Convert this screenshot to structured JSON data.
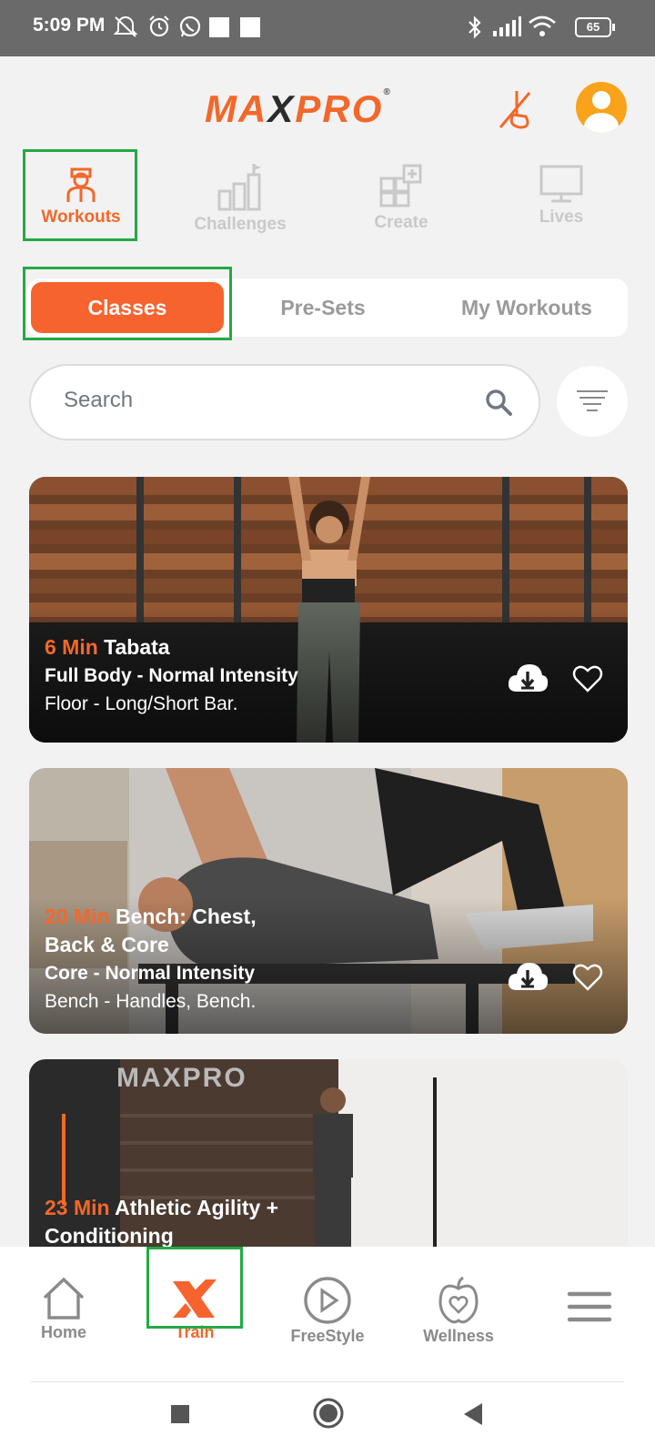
{
  "status_bar": {
    "time": "5:09 PM",
    "battery": "65",
    "icons": [
      "mute-icon",
      "alarm-icon",
      "whatsapp-icon",
      "bluetooth-icon",
      "signal-icon",
      "wifi-icon"
    ]
  },
  "header": {
    "logo_text_left": "MA",
    "logo_text_x": "X",
    "logo_text_right": "PRO",
    "logo_reg": "®"
  },
  "category_tabs": [
    {
      "label": "Workouts",
      "icon": "trainer-icon",
      "active": true
    },
    {
      "label": "Challenges",
      "icon": "podium-flag-icon",
      "active": false
    },
    {
      "label": "Create",
      "icon": "grid-plus-icon",
      "active": false
    },
    {
      "label": "Lives",
      "icon": "monitor-icon",
      "active": false
    }
  ],
  "segments": [
    {
      "label": "Classes",
      "active": true
    },
    {
      "label": "Pre-Sets",
      "active": false
    },
    {
      "label": "My Workouts",
      "active": false
    }
  ],
  "search": {
    "placeholder": "Search"
  },
  "cards": [
    {
      "duration": "6 Min",
      "title": "Tabata",
      "subtitle": "Full Body - Normal Intensity",
      "equipment": "Floor - Long/Short Bar."
    },
    {
      "duration": "20 Min",
      "title": "Bench: Chest,",
      "title_line2": "Back & Core",
      "subtitle": "Core - Normal Intensity",
      "equipment": "Bench - Handles, Bench."
    },
    {
      "duration": "23 Min",
      "title": "Athletic Agility +",
      "title_line2": "Conditioning"
    }
  ],
  "bottom_nav": [
    {
      "label": "Home",
      "icon": "home-icon",
      "active": false
    },
    {
      "label": "Train",
      "icon": "maxpro-x-icon",
      "active": true
    },
    {
      "label": "FreeStyle",
      "icon": "play-circle-icon",
      "active": false
    },
    {
      "label": "Wellness",
      "icon": "apple-heart-icon",
      "active": false
    },
    {
      "label": "",
      "icon": "menu-icon",
      "active": false
    }
  ],
  "colors": {
    "accent": "#f6632f",
    "highlight": "#22aa44",
    "background": "#f2f2f2"
  }
}
